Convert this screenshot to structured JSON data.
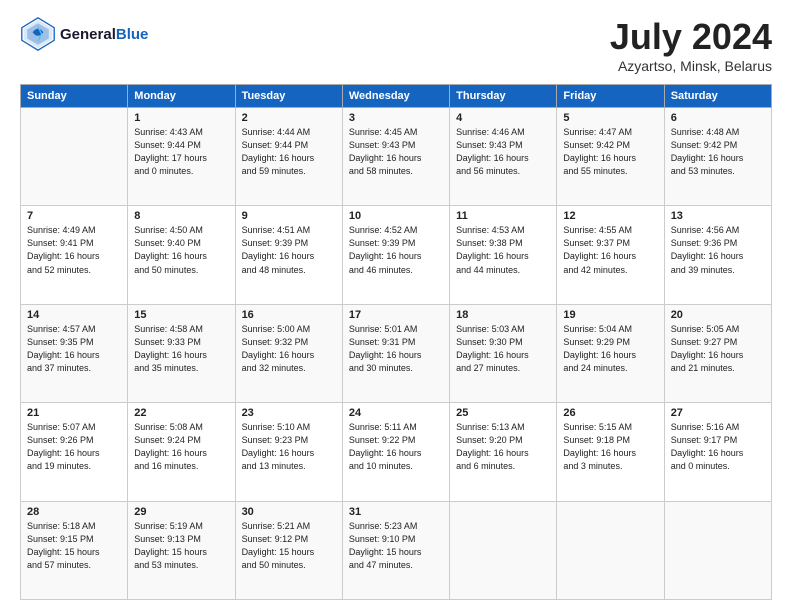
{
  "header": {
    "logo_line1": "General",
    "logo_line2": "Blue",
    "month": "July 2024",
    "location": "Azyartso, Minsk, Belarus"
  },
  "columns": [
    "Sunday",
    "Monday",
    "Tuesday",
    "Wednesday",
    "Thursday",
    "Friday",
    "Saturday"
  ],
  "weeks": [
    [
      {
        "day": "",
        "info": ""
      },
      {
        "day": "1",
        "info": "Sunrise: 4:43 AM\nSunset: 9:44 PM\nDaylight: 17 hours\nand 0 minutes."
      },
      {
        "day": "2",
        "info": "Sunrise: 4:44 AM\nSunset: 9:44 PM\nDaylight: 16 hours\nand 59 minutes."
      },
      {
        "day": "3",
        "info": "Sunrise: 4:45 AM\nSunset: 9:43 PM\nDaylight: 16 hours\nand 58 minutes."
      },
      {
        "day": "4",
        "info": "Sunrise: 4:46 AM\nSunset: 9:43 PM\nDaylight: 16 hours\nand 56 minutes."
      },
      {
        "day": "5",
        "info": "Sunrise: 4:47 AM\nSunset: 9:42 PM\nDaylight: 16 hours\nand 55 minutes."
      },
      {
        "day": "6",
        "info": "Sunrise: 4:48 AM\nSunset: 9:42 PM\nDaylight: 16 hours\nand 53 minutes."
      }
    ],
    [
      {
        "day": "7",
        "info": "Sunrise: 4:49 AM\nSunset: 9:41 PM\nDaylight: 16 hours\nand 52 minutes."
      },
      {
        "day": "8",
        "info": "Sunrise: 4:50 AM\nSunset: 9:40 PM\nDaylight: 16 hours\nand 50 minutes."
      },
      {
        "day": "9",
        "info": "Sunrise: 4:51 AM\nSunset: 9:39 PM\nDaylight: 16 hours\nand 48 minutes."
      },
      {
        "day": "10",
        "info": "Sunrise: 4:52 AM\nSunset: 9:39 PM\nDaylight: 16 hours\nand 46 minutes."
      },
      {
        "day": "11",
        "info": "Sunrise: 4:53 AM\nSunset: 9:38 PM\nDaylight: 16 hours\nand 44 minutes."
      },
      {
        "day": "12",
        "info": "Sunrise: 4:55 AM\nSunset: 9:37 PM\nDaylight: 16 hours\nand 42 minutes."
      },
      {
        "day": "13",
        "info": "Sunrise: 4:56 AM\nSunset: 9:36 PM\nDaylight: 16 hours\nand 39 minutes."
      }
    ],
    [
      {
        "day": "14",
        "info": "Sunrise: 4:57 AM\nSunset: 9:35 PM\nDaylight: 16 hours\nand 37 minutes."
      },
      {
        "day": "15",
        "info": "Sunrise: 4:58 AM\nSunset: 9:33 PM\nDaylight: 16 hours\nand 35 minutes."
      },
      {
        "day": "16",
        "info": "Sunrise: 5:00 AM\nSunset: 9:32 PM\nDaylight: 16 hours\nand 32 minutes."
      },
      {
        "day": "17",
        "info": "Sunrise: 5:01 AM\nSunset: 9:31 PM\nDaylight: 16 hours\nand 30 minutes."
      },
      {
        "day": "18",
        "info": "Sunrise: 5:03 AM\nSunset: 9:30 PM\nDaylight: 16 hours\nand 27 minutes."
      },
      {
        "day": "19",
        "info": "Sunrise: 5:04 AM\nSunset: 9:29 PM\nDaylight: 16 hours\nand 24 minutes."
      },
      {
        "day": "20",
        "info": "Sunrise: 5:05 AM\nSunset: 9:27 PM\nDaylight: 16 hours\nand 21 minutes."
      }
    ],
    [
      {
        "day": "21",
        "info": "Sunrise: 5:07 AM\nSunset: 9:26 PM\nDaylight: 16 hours\nand 19 minutes."
      },
      {
        "day": "22",
        "info": "Sunrise: 5:08 AM\nSunset: 9:24 PM\nDaylight: 16 hours\nand 16 minutes."
      },
      {
        "day": "23",
        "info": "Sunrise: 5:10 AM\nSunset: 9:23 PM\nDaylight: 16 hours\nand 13 minutes."
      },
      {
        "day": "24",
        "info": "Sunrise: 5:11 AM\nSunset: 9:22 PM\nDaylight: 16 hours\nand 10 minutes."
      },
      {
        "day": "25",
        "info": "Sunrise: 5:13 AM\nSunset: 9:20 PM\nDaylight: 16 hours\nand 6 minutes."
      },
      {
        "day": "26",
        "info": "Sunrise: 5:15 AM\nSunset: 9:18 PM\nDaylight: 16 hours\nand 3 minutes."
      },
      {
        "day": "27",
        "info": "Sunrise: 5:16 AM\nSunset: 9:17 PM\nDaylight: 16 hours\nand 0 minutes."
      }
    ],
    [
      {
        "day": "28",
        "info": "Sunrise: 5:18 AM\nSunset: 9:15 PM\nDaylight: 15 hours\nand 57 minutes."
      },
      {
        "day": "29",
        "info": "Sunrise: 5:19 AM\nSunset: 9:13 PM\nDaylight: 15 hours\nand 53 minutes."
      },
      {
        "day": "30",
        "info": "Sunrise: 5:21 AM\nSunset: 9:12 PM\nDaylight: 15 hours\nand 50 minutes."
      },
      {
        "day": "31",
        "info": "Sunrise: 5:23 AM\nSunset: 9:10 PM\nDaylight: 15 hours\nand 47 minutes."
      },
      {
        "day": "",
        "info": ""
      },
      {
        "day": "",
        "info": ""
      },
      {
        "day": "",
        "info": ""
      }
    ]
  ]
}
